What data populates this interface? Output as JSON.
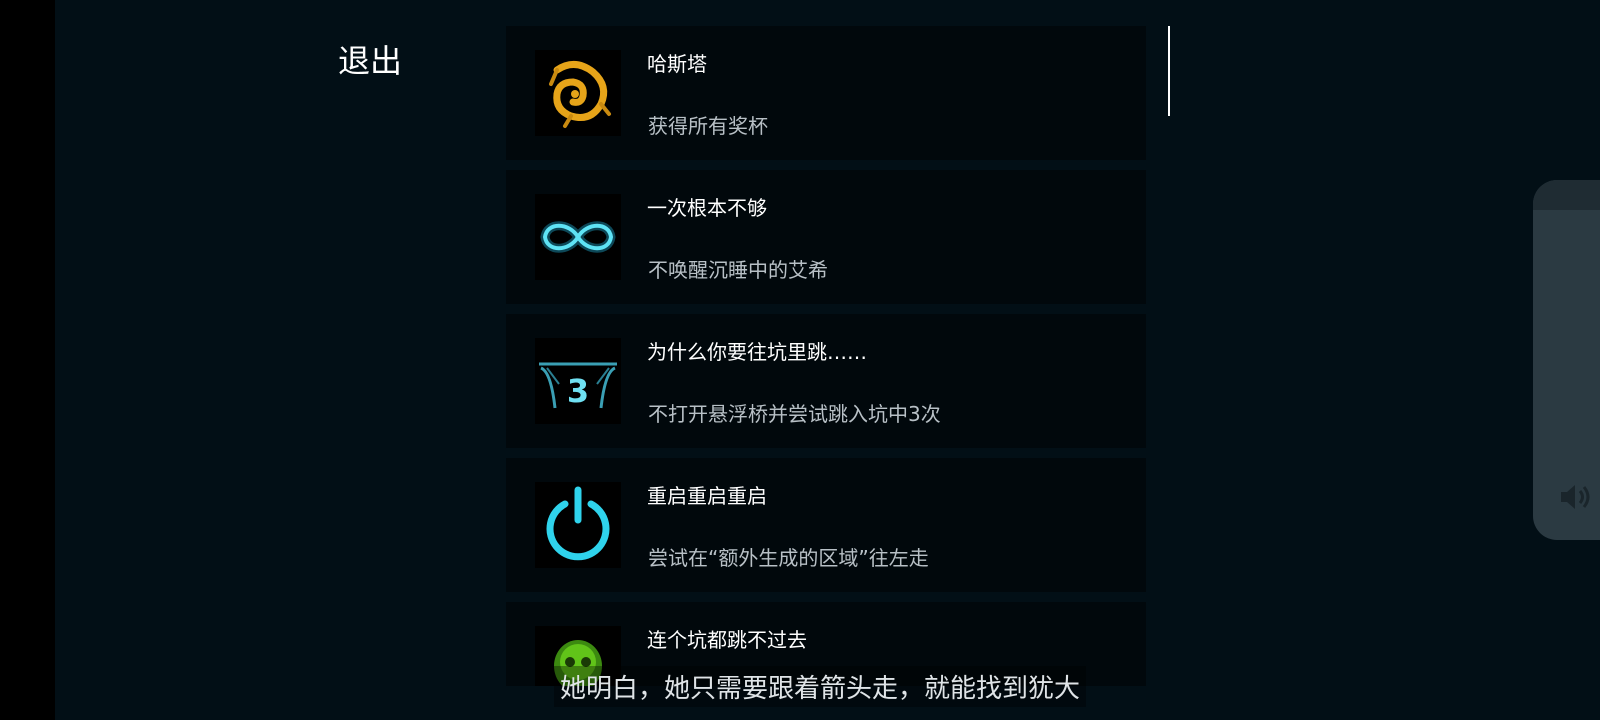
{
  "menu": {
    "exit_label": "退出"
  },
  "achievements": [
    {
      "title": "哈斯塔",
      "description": "获得所有奖杯",
      "icon": "hastur-sigil-icon"
    },
    {
      "title": "一次根本不够",
      "description": "不唤醒沉睡中的艾希",
      "icon": "infinity-icon"
    },
    {
      "title": "为什么你要往坑里跳……",
      "description": "不打开悬浮桥并尝试跳入坑中3次",
      "icon": "bridge-pit-icon",
      "icon_text": "3"
    },
    {
      "title": "重启重启重启",
      "description": "尝试在“额外生成的区域”往左走",
      "icon": "power-icon"
    },
    {
      "title": "连个坑都跳不过去",
      "description": "",
      "icon": "green-skull-icon"
    }
  ],
  "subtitle": "她明白，她只需要跟着箭头走，就能找到犹大",
  "colors": {
    "background": "#020f16",
    "card": "#01080c",
    "cyan_accent": "#22c5e0",
    "gold_accent": "#e6a419",
    "green_accent": "#6ad21c",
    "side_panel": "#2b3a42"
  }
}
